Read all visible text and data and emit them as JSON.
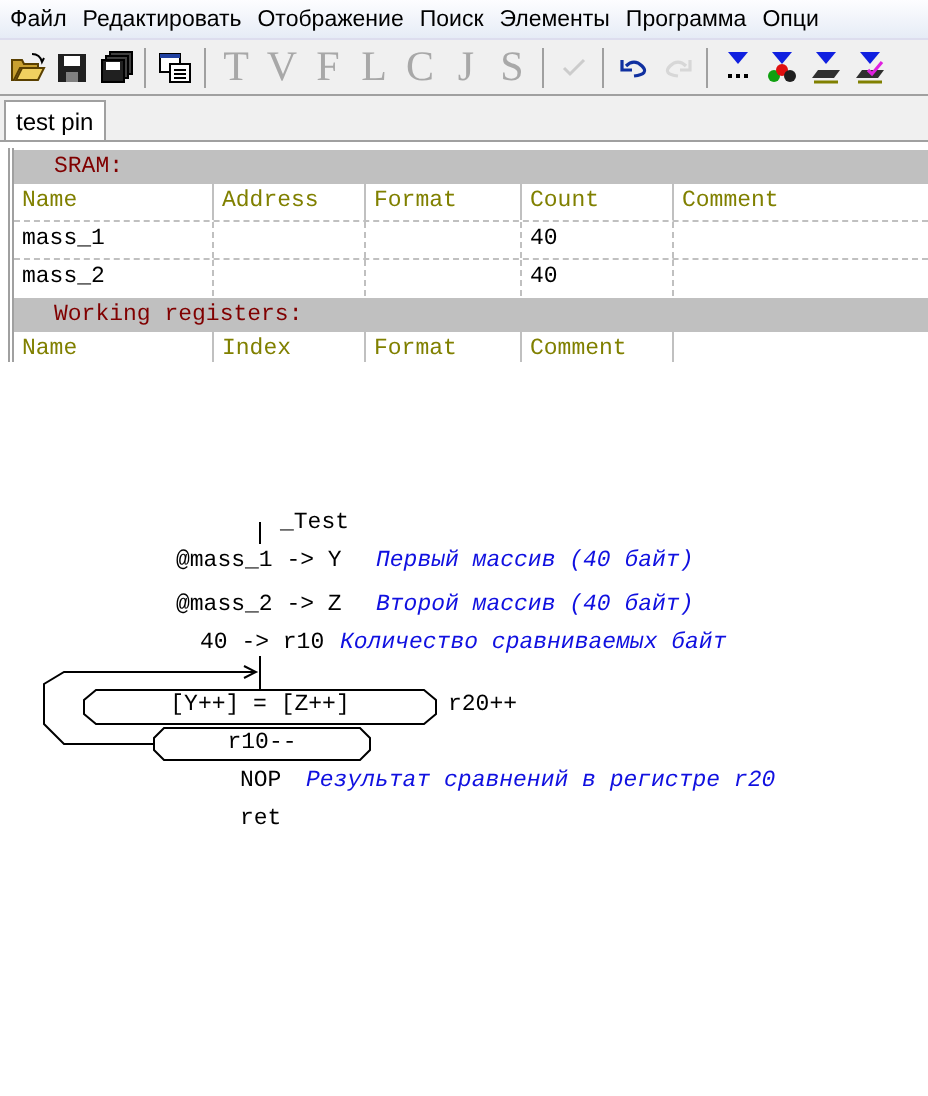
{
  "menu": [
    "Файл",
    "Редактировать",
    "Отображение",
    "Поиск",
    "Элементы",
    "Программа",
    "Опци"
  ],
  "toolbar": [
    {
      "kind": "open",
      "disabled": false
    },
    {
      "kind": "save",
      "disabled": false
    },
    {
      "kind": "saveall",
      "disabled": false
    },
    {
      "kind": "sep"
    },
    {
      "kind": "window",
      "disabled": false
    },
    {
      "kind": "sep"
    },
    {
      "kind": "letter",
      "label": "T",
      "disabled": true
    },
    {
      "kind": "letter",
      "label": "V",
      "disabled": true
    },
    {
      "kind": "letter",
      "label": "F",
      "disabled": true
    },
    {
      "kind": "letter",
      "label": "L",
      "disabled": true
    },
    {
      "kind": "letter",
      "label": "C",
      "disabled": true
    },
    {
      "kind": "letter",
      "label": "J",
      "disabled": true
    },
    {
      "kind": "letter",
      "label": "S",
      "disabled": true
    },
    {
      "kind": "sep"
    },
    {
      "kind": "check",
      "disabled": true
    },
    {
      "kind": "sep"
    },
    {
      "kind": "undo",
      "disabled": false
    },
    {
      "kind": "redo",
      "disabled": true
    },
    {
      "kind": "sep"
    },
    {
      "kind": "dots",
      "disabled": false
    },
    {
      "kind": "balls",
      "disabled": false
    },
    {
      "kind": "chip",
      "disabled": false
    },
    {
      "kind": "chipcheck",
      "disabled": false
    }
  ],
  "tabs": [
    {
      "label": "test pin",
      "selected": true
    }
  ],
  "sections": [
    {
      "title": "SRAM:",
      "columns": [
        "Name",
        "Address",
        "Format",
        "Count",
        "Comment"
      ],
      "rows": [
        [
          "mass_1",
          "",
          "",
          "40",
          ""
        ],
        [
          "mass_2",
          "",
          "",
          "40",
          ""
        ]
      ]
    },
    {
      "title": "Working registers:",
      "columns": [
        "Name",
        "Index",
        "Format",
        "Comment"
      ]
    }
  ],
  "diagram": {
    "label": "_Test",
    "lines": [
      {
        "code": "@mass_1 -> Y",
        "comment": "Первый массив (40 байт)"
      },
      {
        "code": "@mass_2 -> Z",
        "comment": "Второй массив (40 байт)"
      },
      {
        "code": "40 -> r10",
        "comment": "Количество сравниваемых байт"
      }
    ],
    "loop": {
      "body": "[Y++] = [Z++]",
      "side": "r20++",
      "counter": "r10--"
    },
    "tail": [
      {
        "code": "NOP",
        "comment": "Результат сравнений в регистре r20"
      },
      {
        "code": "ret"
      }
    ]
  }
}
